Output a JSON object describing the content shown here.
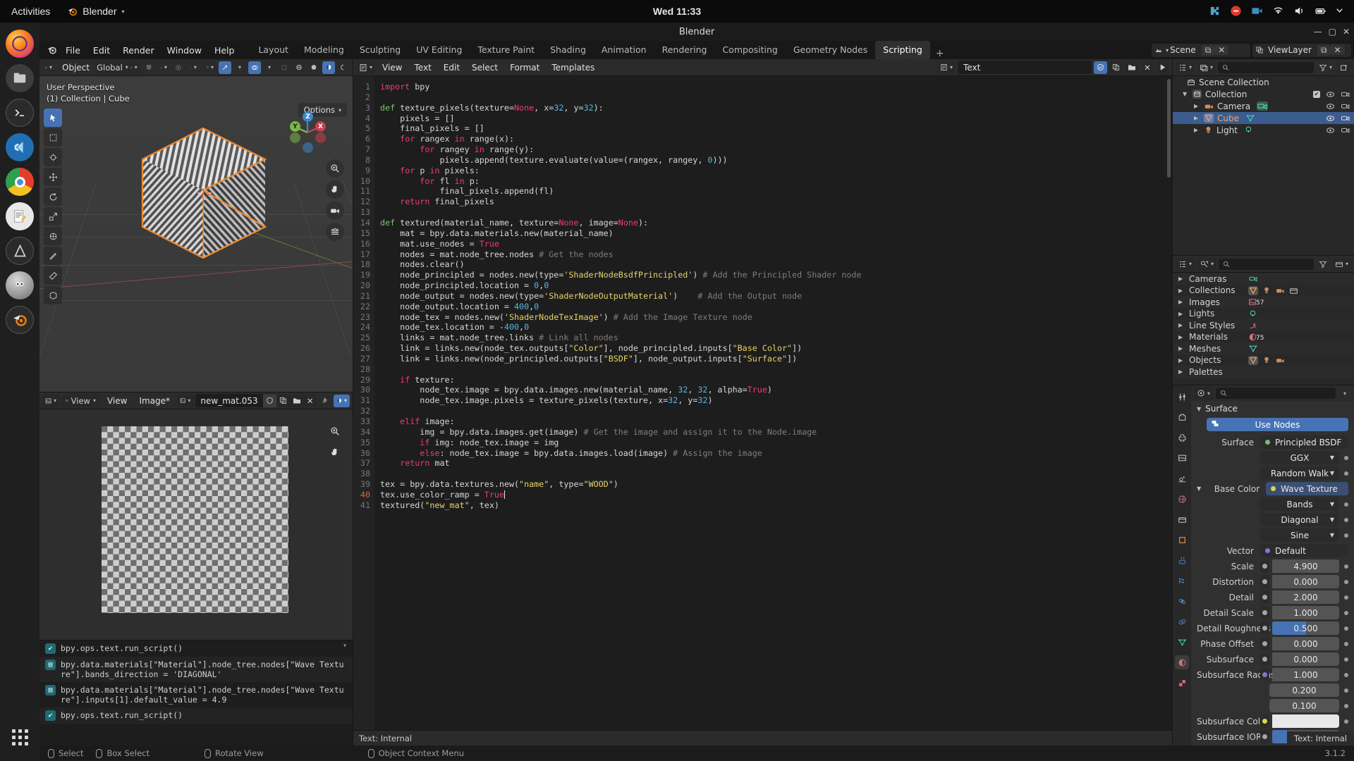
{
  "desktop": {
    "activities": "Activities",
    "app_name": "Blender",
    "clock": "Wed 11:33",
    "tray_icons": [
      "puzzle-icon",
      "record-icon",
      "camera-icon",
      "wifi-icon",
      "volume-icon",
      "battery-icon",
      "power-icon"
    ],
    "dock_apps": [
      "firefox",
      "files",
      "terminal",
      "vscode",
      "chrome",
      "text-editor",
      "android-studio",
      "gimp",
      "blender"
    ]
  },
  "window": {
    "title": "Blender",
    "buttons": [
      "minimize",
      "maximize",
      "close"
    ]
  },
  "topbar": {
    "logo": "blender-logo",
    "menus": [
      "File",
      "Edit",
      "Render",
      "Window",
      "Help"
    ],
    "workspaces": [
      "Layout",
      "Modeling",
      "Sculpting",
      "UV Editing",
      "Texture Paint",
      "Shading",
      "Animation",
      "Rendering",
      "Compositing",
      "Geometry Nodes",
      "Scripting"
    ],
    "active_workspace": "Scripting",
    "add_workspace": "+",
    "scene_name": "Scene",
    "viewlayer_name": "ViewLayer"
  },
  "viewport3d": {
    "header": {
      "mode": "Object",
      "orientation": "Global",
      "options_label": "Options",
      "icons": [
        "editor-type-icon",
        "transform-orientation-icon",
        "snap-magnet-icon",
        "snap-increment-icon",
        "proportional-edit-icon",
        "falloff-icon",
        "visibility-icon",
        "gizmo-icon",
        "overlays-icon",
        "xray-icon",
        "shading-wireframe-icon",
        "shading-solid-icon",
        "shading-material-icon",
        "shading-rendered-icon"
      ],
      "select_modes": [
        "tweak",
        "select-box",
        "select-circle",
        "select-lasso",
        "select-extend"
      ]
    },
    "overlay_line1": "User Perspective",
    "overlay_line2": "(1) Collection | Cube",
    "gizmo_axes": [
      "Z",
      "Y",
      "X"
    ],
    "tools": [
      "tweak-tool",
      "select-box-tool",
      "cursor-tool",
      "move-tool",
      "rotate-tool",
      "scale-tool",
      "transform-tool",
      "annotate-tool",
      "measure-tool",
      "add-cube-tool"
    ],
    "nav_buttons": [
      "zoom-icon",
      "hand-icon",
      "camera-icon",
      "grid-icon"
    ]
  },
  "image_editor": {
    "header": {
      "editor_icon": "image-editor-icon",
      "mode": "View",
      "menus": [
        "View",
        "Image*"
      ],
      "datablock_name": "new_mat.053",
      "buttons": [
        "fake-user-icon",
        "duplicate-icon",
        "open-icon",
        "unlink-icon",
        "pin-icon",
        "display-channels-icon"
      ]
    },
    "nav_buttons": [
      "zoom-icon",
      "hand-icon"
    ]
  },
  "info_editor": {
    "entries": [
      {
        "icon": "check-icon",
        "text": "bpy.ops.text.run_script()"
      },
      {
        "icon": "property-icon",
        "text": "bpy.data.materials[\"Material\"].node_tree.nodes[\"Wave Texture\"].bands_direction = 'DIAGONAL'"
      },
      {
        "icon": "property-icon",
        "text": "bpy.data.materials[\"Material\"].node_tree.nodes[\"Wave Texture\"].inputs[1].default_value = 4.9"
      },
      {
        "icon": "check-icon",
        "text": "bpy.ops.text.run_script()"
      }
    ]
  },
  "text_editor": {
    "header": {
      "editor_icon": "text-editor-icon",
      "menus": [
        "View",
        "Text",
        "Edit",
        "Select",
        "Format",
        "Templates"
      ],
      "datablock_name": "Text",
      "buttons": [
        "register-icon",
        "duplicate-icon",
        "open-icon",
        "unlink-icon",
        "run-script-icon"
      ]
    },
    "footer": "Text: Internal",
    "first_line": 1,
    "total_lines": 41,
    "cursor_line": 40,
    "code_lines": [
      "import bpy",
      "",
      "def texture_pixels(texture=None, x=32, y=32):",
      "    pixels = []",
      "    final_pixels = []",
      "    for rangex in range(x):",
      "        for rangey in range(y):",
      "            pixels.append(texture.evaluate(value=(rangex, rangey, 0)))",
      "    for p in pixels:",
      "        for fl in p:",
      "            final_pixels.append(fl)",
      "    return final_pixels",
      "",
      "def textured(material_name, texture=None, image=None):",
      "    mat = bpy.data.materials.new(material_name)",
      "    mat.use_nodes = True",
      "    nodes = mat.node_tree.nodes # Get the nodes",
      "    nodes.clear()",
      "    node_principled = nodes.new(type='ShaderNodeBsdfPrincipled') # Add the Principled Shader node",
      "    node_principled.location = 0,0",
      "    node_output = nodes.new(type='ShaderNodeOutputMaterial')    # Add the Output node",
      "    node_output.location = 400,0",
      "    node_tex = nodes.new('ShaderNodeTexImage') # Add the Image Texture node",
      "    node_tex.location = -400,0",
      "    links = mat.node_tree.links # Link all nodes",
      "    link = links.new(node_tex.outputs[\"Color\"], node_principled.inputs[\"Base Color\"])",
      "    link = links.new(node_principled.outputs[\"BSDF\"], node_output.inputs[\"Surface\"])",
      "",
      "    if texture:",
      "        node_tex.image = bpy.data.images.new(material_name, 32, 32, alpha=True)",
      "        node_tex.image.pixels = texture_pixels(texture, x=32, y=32)",
      "",
      "    elif image:",
      "        img = bpy.data.images.get(image) # Get the image and assign it to the Node.image",
      "        if img: node_tex.image = img",
      "        else: node_tex.image = bpy.data.images.load(image) # Assign the image",
      "    return mat",
      "",
      "tex = bpy.data.textures.new(\"name\", type=\"WOOD\")",
      "tex.use_color_ramp = True",
      "textured(\"new_mat\", tex)"
    ]
  },
  "outliner": {
    "header_buttons": [
      "display-mode-icon",
      "filter-id-icon",
      "filter-icon",
      "new-collection-icon"
    ],
    "search_placeholder": "",
    "rows": [
      {
        "label": "Scene Collection",
        "icon": "collection-icon",
        "depth": 0,
        "selected": false,
        "expand": "",
        "extra_icons": [],
        "right": []
      },
      {
        "label": "Collection",
        "icon": "collection-icon",
        "depth": 1,
        "selected": false,
        "expand": "down",
        "extra_icons": [],
        "right": [
          "checkbox",
          "eye",
          "camera"
        ]
      },
      {
        "label": "Camera",
        "icon": "camera-object-icon",
        "depth": 2,
        "selected": false,
        "expand": "right",
        "extra_icons": [
          "camera-data-icon"
        ],
        "right": [
          "eye",
          "camera"
        ]
      },
      {
        "label": "Cube",
        "icon": "mesh-object-icon",
        "depth": 2,
        "selected": true,
        "expand": "right",
        "extra_icons": [
          "mesh-data-icon"
        ],
        "right": [
          "eye",
          "camera"
        ]
      },
      {
        "label": "Light",
        "icon": "light-object-icon",
        "depth": 2,
        "selected": false,
        "expand": "right",
        "extra_icons": [
          "light-data-icon"
        ],
        "right": [
          "eye",
          "camera"
        ]
      }
    ]
  },
  "blend_data": {
    "header_buttons": [
      "display-mode-icon",
      "filter-id-icon",
      "filter-icon",
      "collection-icon"
    ],
    "rows": [
      {
        "label": "Cameras",
        "icons": [
          "camera-data-icon"
        ],
        "count": ""
      },
      {
        "label": "Collections",
        "icons": [
          "mesh-object-icon",
          "light-object-icon",
          "camera-object-icon",
          "collection-icon"
        ],
        "count": ""
      },
      {
        "label": "Images",
        "icons": [
          "image-icon"
        ],
        "count": "57"
      },
      {
        "label": "Lights",
        "icons": [
          "light-data-icon"
        ],
        "count": ""
      },
      {
        "label": "Line Styles",
        "icons": [
          "linestyle-icon"
        ],
        "count": ""
      },
      {
        "label": "Materials",
        "icons": [
          "material-icon"
        ],
        "count": "75"
      },
      {
        "label": "Meshes",
        "icons": [
          "mesh-data-icon"
        ],
        "count": ""
      },
      {
        "label": "Objects",
        "icons": [
          "mesh-object-icon",
          "light-object-icon",
          "camera-object-icon"
        ],
        "count": ""
      },
      {
        "label": "Palettes",
        "icons": [],
        "count": ""
      }
    ]
  },
  "properties": {
    "tabs": [
      "tool-icon",
      "render-icon",
      "output-icon",
      "viewlayer-icon",
      "scene-icon",
      "world-icon",
      "collection-icon",
      "object-icon",
      "modifier-icon",
      "particles-icon",
      "physics-icon",
      "constraints-icon",
      "data-icon",
      "material-icon",
      "texture-icon"
    ],
    "active_tab": "material-icon",
    "search_placeholder": "",
    "panel_title": "Surface",
    "use_nodes_label": "Use Nodes",
    "rows": [
      {
        "label": "Surface",
        "value": "Principled BSDF",
        "type": "link",
        "dot": "#6ec06e"
      },
      {
        "label": "",
        "value": "GGX",
        "type": "menu"
      },
      {
        "label": "",
        "value": "Random Walk",
        "type": "menu"
      },
      {
        "label": "Base Color",
        "value": "Wave Texture",
        "type": "link-hl",
        "dot": "#d7d84b"
      },
      {
        "label": "",
        "value": "Bands",
        "type": "menu"
      },
      {
        "label": "",
        "value": "Diagonal",
        "type": "menu"
      },
      {
        "label": "",
        "value": "Sine",
        "type": "menu"
      },
      {
        "label": "Vector",
        "value": "Default",
        "type": "link",
        "dot": "#7b76d8"
      },
      {
        "label": "Scale",
        "value": "4.900",
        "type": "number",
        "dot": "#a5a5a5"
      },
      {
        "label": "Distortion",
        "value": "0.000",
        "type": "number",
        "dot": "#a5a5a5"
      },
      {
        "label": "Detail",
        "value": "2.000",
        "type": "number",
        "dot": "#a5a5a5"
      },
      {
        "label": "Detail Scale",
        "value": "1.000",
        "type": "number",
        "dot": "#a5a5a5"
      },
      {
        "label": "Detail Roughness",
        "value": "0.500",
        "type": "slider",
        "dot": "#a5a5a5",
        "fill": 50
      },
      {
        "label": "Phase Offset",
        "value": "0.000",
        "type": "number",
        "dot": "#a5a5a5"
      },
      {
        "label": "Subsurface",
        "value": "0.000",
        "type": "number",
        "dot": "#a5a5a5"
      },
      {
        "label": "Subsurface Radius",
        "value": "1.000",
        "type": "number",
        "dot": "#7b76d8"
      },
      {
        "label": "",
        "value": "0.200",
        "type": "number-sub"
      },
      {
        "label": "",
        "value": "0.100",
        "type": "number-sub"
      },
      {
        "label": "Subsurface Color",
        "value": "",
        "type": "color",
        "dot": "#d7d84b"
      },
      {
        "label": "Subsurface IOR",
        "value": "1.400",
        "type": "slider",
        "dot": "#a5a5a5",
        "fill": 22
      }
    ]
  },
  "statusbar": {
    "items": [
      {
        "icon": "mouse-left-icon",
        "label": "Select"
      },
      {
        "icon": "mouse-drag-icon",
        "label": "Box Select"
      },
      {
        "icon": "mouse-middle-icon",
        "label": "Rotate View"
      },
      {
        "icon": "mouse-right-icon",
        "label": "Object Context Menu"
      }
    ],
    "version": "3.1.2"
  }
}
